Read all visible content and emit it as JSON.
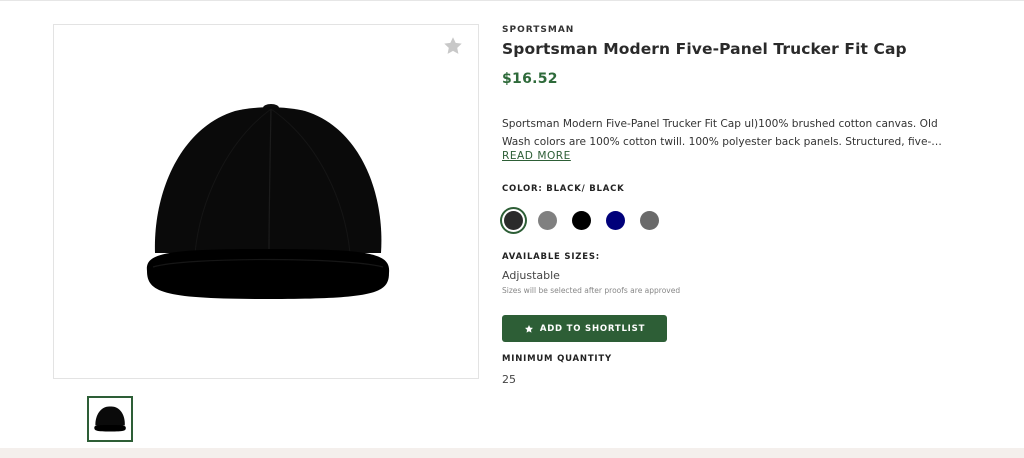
{
  "product": {
    "brand": "SPORTSMAN",
    "title": "Sportsman Modern Five-Panel Trucker Fit Cap",
    "price": "$16.52",
    "description": "Sportsman Modern Five-Panel Trucker Fit Cap ul)100% brushed cotton canvas. Old Wash colors are 100% cotton twill. 100% polyester back panels. Structured, five-…",
    "read_more_label": "READ MORE",
    "color_label": "COLOR: BLACK/ BLACK",
    "colors": [
      {
        "name": "Black/ Black",
        "hex": "#2b2b2b",
        "selected": true
      },
      {
        "name": "Grey",
        "hex": "#808080",
        "selected": false
      },
      {
        "name": "Black",
        "hex": "#000000",
        "selected": false
      },
      {
        "name": "Navy",
        "hex": "#00007a",
        "selected": false
      },
      {
        "name": "Dark Grey",
        "hex": "#6a6a6a",
        "selected": false
      }
    ],
    "sizes_label": "AVAILABLE SIZES:",
    "size_value": "Adjustable",
    "size_note": "Sizes will be selected after proofs are approved",
    "shortlist_label": "ADD TO SHORTLIST",
    "min_qty_label": "MINIMUM QUANTITY",
    "min_qty_value": "25"
  },
  "icons": {
    "favorite": "star-icon",
    "shortlist": "star-icon"
  },
  "theme": {
    "accent": "#2d5e36",
    "price_color": "#2e6a3a"
  }
}
